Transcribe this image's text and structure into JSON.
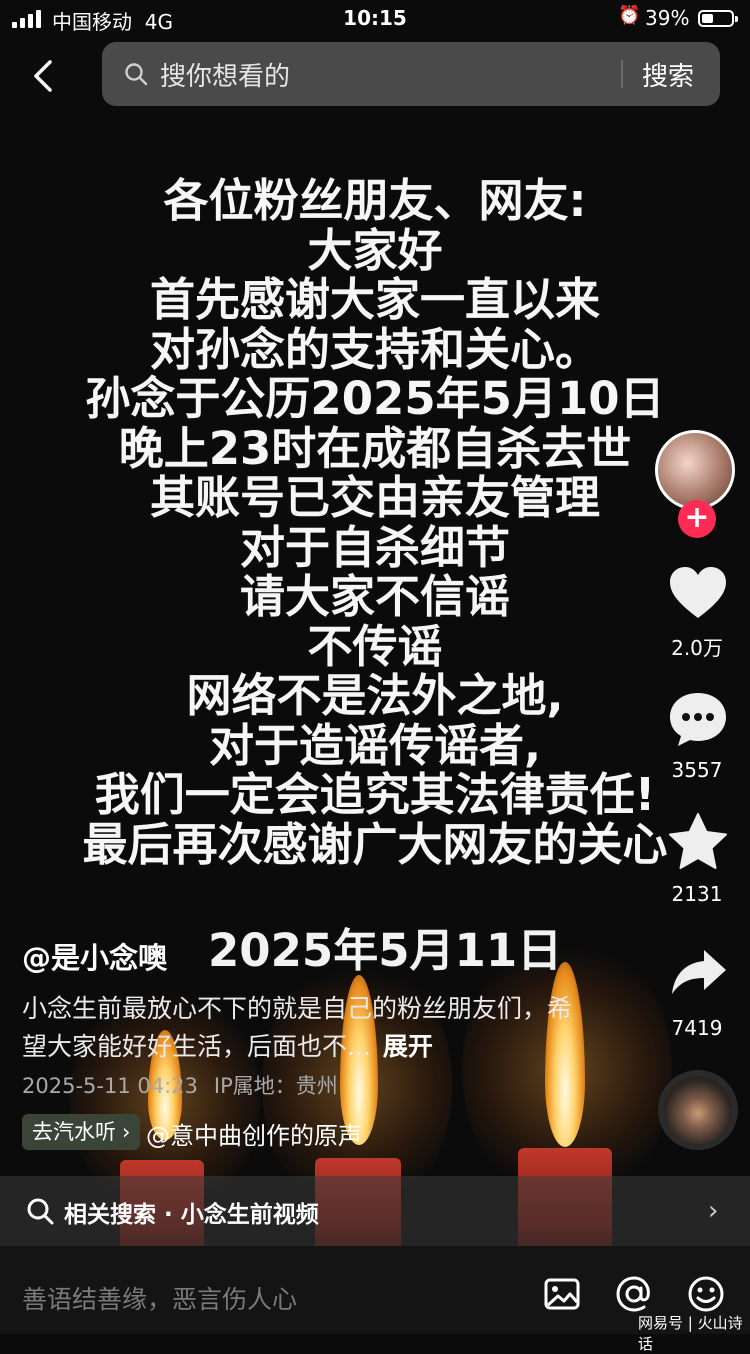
{
  "status_bar": {
    "carrier": "中国移动",
    "network": "4G",
    "time": "10:15",
    "battery": "39%",
    "battery_level": 0.39
  },
  "search": {
    "placeholder": "搜你想看的",
    "button": "搜索"
  },
  "notice_lines": [
    "各位粉丝朋友、网友:",
    "大家好",
    "首先感谢大家一直以来",
    "对孙念的支持和关心。",
    "孙念于公历2025年5月10日",
    "晚上23时在成都自杀去世",
    "其账号已交由亲友管理",
    "对于自杀细节",
    "请大家不信谣",
    "不传谣",
    "网络不是法外之地,",
    "对于造谣传谣者,",
    "我们一定会追究其法律责任!",
    "最后再次感谢广大网友的关心"
  ],
  "notice_date": "2025年5月11日",
  "rail": {
    "likes": "2.0万",
    "comments": "3557",
    "favorites": "2131",
    "shares": "7419"
  },
  "post": {
    "author": "@是小念噢",
    "description": "小念生前最放心不下的就是自己的粉丝朋友们，希望大家能好好生活，后面也不...",
    "expand": "展开",
    "datetime": "2025-5-11 04:23",
    "ip_location": "IP属地：贵州",
    "chip": "去汽水听",
    "sound": "@意中曲创作的原声"
  },
  "related": {
    "text": "相关搜索 · 小念生前视频"
  },
  "bottom": {
    "comment_placeholder": "善语结善缘，恶言伤人心",
    "watermark": "网易号 | 火山诗话"
  },
  "colors": {
    "follow_red": "#fe2c55",
    "background": "#0b0b0b"
  },
  "icons": [
    "back-icon",
    "search-icon",
    "heart-icon",
    "comment-icon",
    "star-icon",
    "share-icon",
    "image-icon",
    "at-icon",
    "emoji-icon"
  ]
}
